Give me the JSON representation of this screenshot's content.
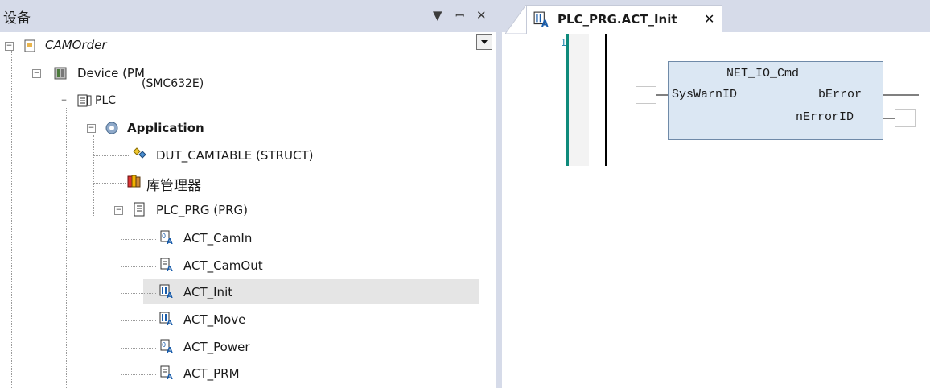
{
  "panel": {
    "title": "设备",
    "dropdown_icon": "triangle-down",
    "pin_icon": "pin",
    "close_icon": "close"
  },
  "tree": {
    "root": {
      "label": "CAMOrder"
    },
    "device": {
      "label": "Device (PM",
      "sublabel": "(SMC632E)"
    },
    "plc": {
      "label": "PLC"
    },
    "application": {
      "label": "Application"
    },
    "items": [
      {
        "label": "DUT_CAMTABLE (STRUCT)"
      },
      {
        "label": "库管理器"
      },
      {
        "label": "PLC_PRG (PRG)"
      }
    ],
    "actions": [
      {
        "label": "ACT_CamIn"
      },
      {
        "label": "ACT_CamOut"
      },
      {
        "label": "ACT_Init"
      },
      {
        "label": "ACT_Move"
      },
      {
        "label": "ACT_Power"
      },
      {
        "label": "ACT_PRM"
      }
    ]
  },
  "editor": {
    "tab_label": "PLC_PRG.ACT_Init",
    "tab_close": "✕",
    "line_number": "1",
    "block": {
      "name": "NET_IO_Cmd",
      "input": "SysWarnID",
      "output1": "bError",
      "output2": "nErrorID"
    }
  },
  "colors": {
    "header_bg": "#d6dbe9",
    "block_fill": "#dbe7f3",
    "gutter_accent": "#0e8a7b",
    "selection": "#e5e5e5"
  }
}
